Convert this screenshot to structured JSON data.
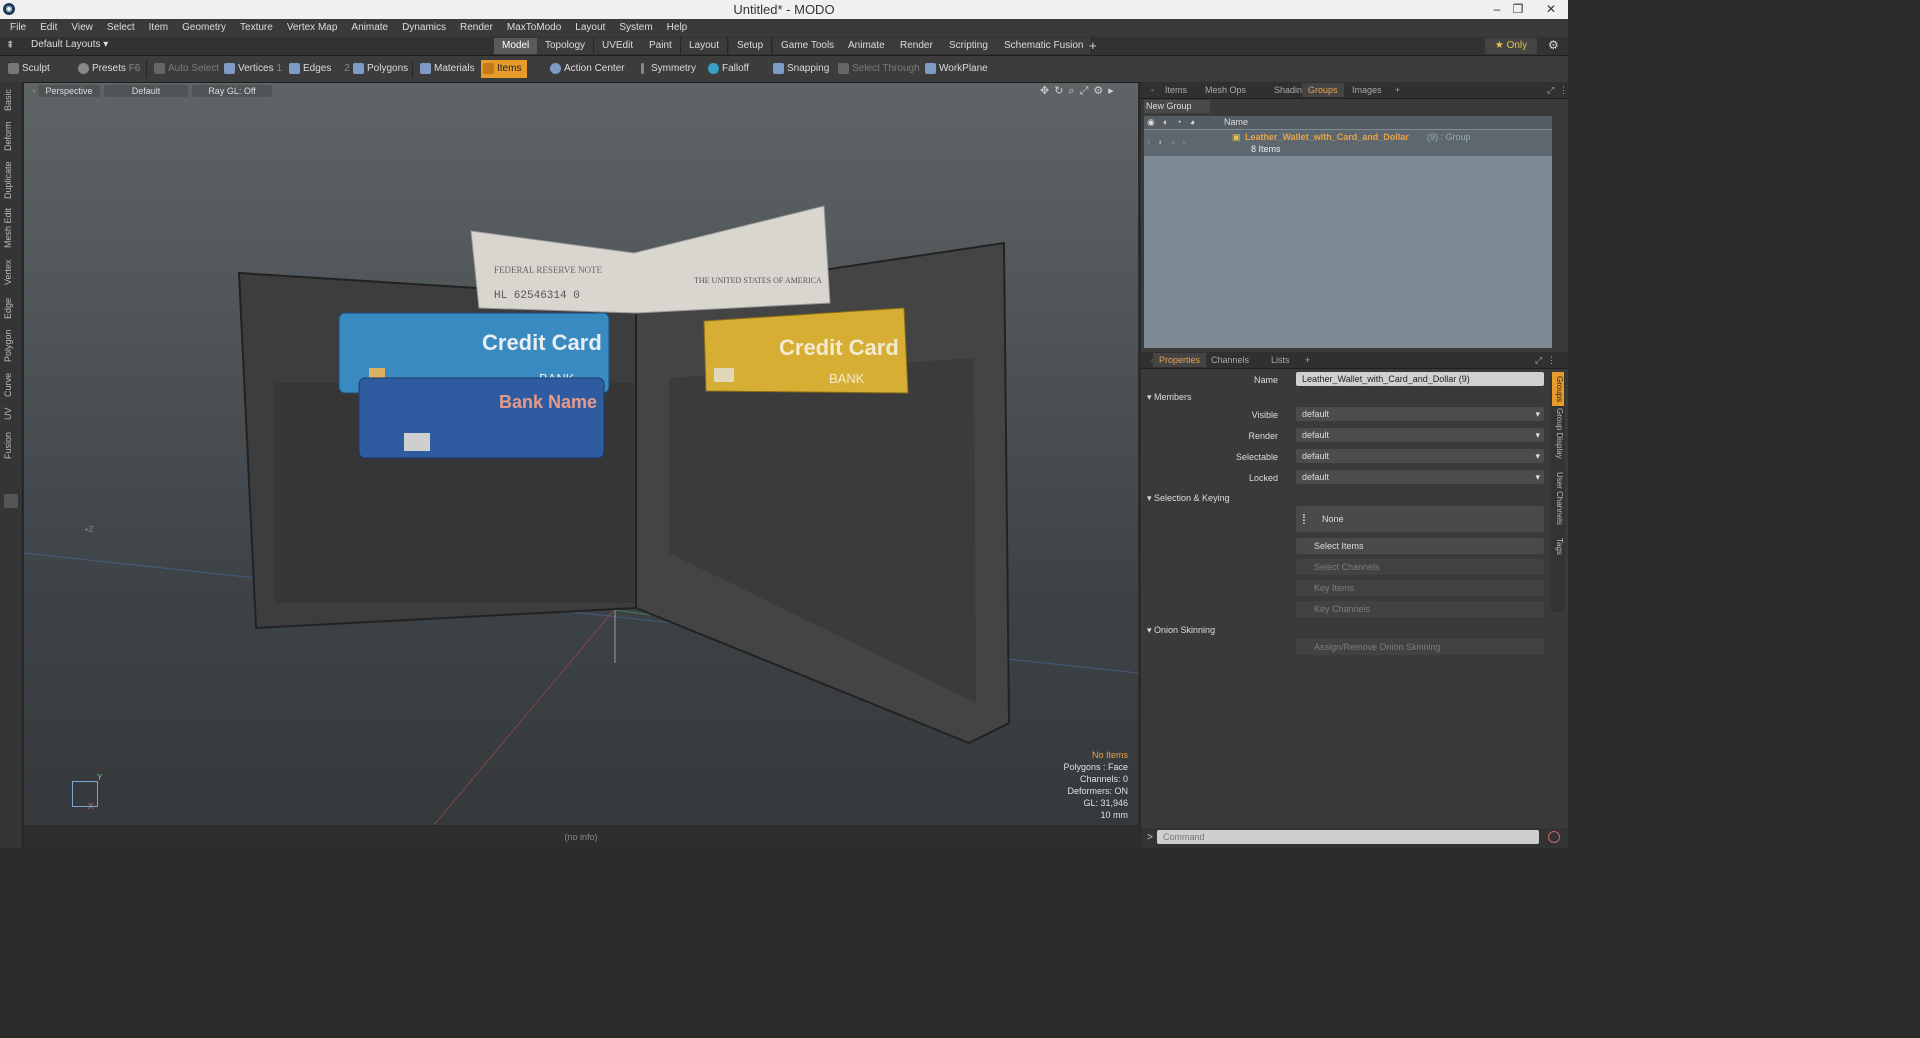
{
  "window": {
    "title": "Untitled* - MODO",
    "minimize": "–",
    "restore": "❐",
    "close": "✕"
  },
  "menu": [
    "File",
    "Edit",
    "View",
    "Select",
    "Item",
    "Geometry",
    "Texture",
    "Vertex Map",
    "Animate",
    "Dynamics",
    "Render",
    "MaxToModo",
    "Layout",
    "System",
    "Help"
  ],
  "layout_selector": "Default Layouts ▾",
  "layout_tabs": [
    {
      "label": "Model",
      "active": true
    },
    {
      "label": "Topology"
    },
    {
      "label": "UVEdit"
    },
    {
      "label": "Paint"
    },
    {
      "label": "Layout"
    },
    {
      "label": "Setup"
    },
    {
      "label": "Game Tools"
    },
    {
      "label": "Animate"
    },
    {
      "label": "Render"
    },
    {
      "label": "Scripting"
    },
    {
      "label": "Schematic Fusion"
    }
  ],
  "layout_add": "+",
  "only_label": "★ Only",
  "toolbar": {
    "sculpt": "Sculpt",
    "presets": "Presets",
    "presets_key": "F6",
    "auto_select": "Auto Select",
    "vertices": "Vertices",
    "vertices_key": "1",
    "edges": "Edges",
    "edges_key": "2",
    "polygons": "Polygons",
    "materials": "Materials",
    "items": "Items",
    "action_center": "Action Center",
    "symmetry": "Symmetry",
    "falloff": "Falloff",
    "snapping": "Snapping",
    "select_through": "Select Through",
    "workplane": "WorkPlane"
  },
  "left_tabs": [
    "Basic",
    "Deform",
    "Duplicate",
    "Mesh Edit",
    "Vertex",
    "Edge",
    "Polygon",
    "Curve",
    "UV",
    "Fusion"
  ],
  "viewport": {
    "view": "Perspective",
    "shading": "Default",
    "raygl": "Ray GL: Off",
    "axis_z": "+Z",
    "axis_y": "Y",
    "axis_x": "X",
    "info": [
      "No Items",
      "Polygons : Face",
      "Channels: 0",
      "Deformers: ON",
      "GL: 31,946",
      "10 mm"
    ],
    "info_highlight": "#e8a34a",
    "scene": {
      "card1": "Credit Card",
      "card1_sub": "BANK",
      "card2": "Bank Name",
      "card3": "Credit Card",
      "card3_sub": "BANK",
      "bill_serial": "HL 62546314 0",
      "bill_text": "THE UNITED STATES OF AMERICA",
      "bill_fed": "FEDERAL RESERVE NOTE"
    }
  },
  "status": "(no info)",
  "top_panel": {
    "tabs": [
      {
        "label": "Items"
      },
      {
        "label": "Mesh Ops"
      },
      {
        "label": "Shading"
      },
      {
        "label": "Groups",
        "active": true
      },
      {
        "label": "Images"
      }
    ],
    "add": "+",
    "new_group": "New Group",
    "name_header": "Name",
    "group_name": "Leather_Wallet_with_Card_and_Dollar",
    "group_suffix": "(9) : Group",
    "group_items": "8 Items"
  },
  "properties": {
    "tabs": [
      {
        "label": "Properties",
        "active": true
      },
      {
        "label": "Channels"
      },
      {
        "label": "Lists"
      }
    ],
    "add": "+",
    "name_label": "Name",
    "name_value": "Leather_Wallet_with_Card_and_Dollar (9)",
    "members": "Members",
    "visible_label": "Visible",
    "visible": "default",
    "render_label": "Render",
    "render": "default",
    "selectable_label": "Selectable",
    "selectable": "default",
    "locked_label": "Locked",
    "locked": "default",
    "sel_keying": "Selection & Keying",
    "none": "None",
    "select_items": "Select Items",
    "select_channels": "Select Channels",
    "key_items": "Key Items",
    "key_channels": "Key Channels",
    "onion": "Onion Skinning",
    "assign_onion": "Assign/Remove Onion Skinning",
    "side_tabs": [
      "Groups",
      "Group Display",
      "User Channels",
      "Tags"
    ]
  },
  "command": {
    "prompt": ">",
    "placeholder": "Command"
  }
}
